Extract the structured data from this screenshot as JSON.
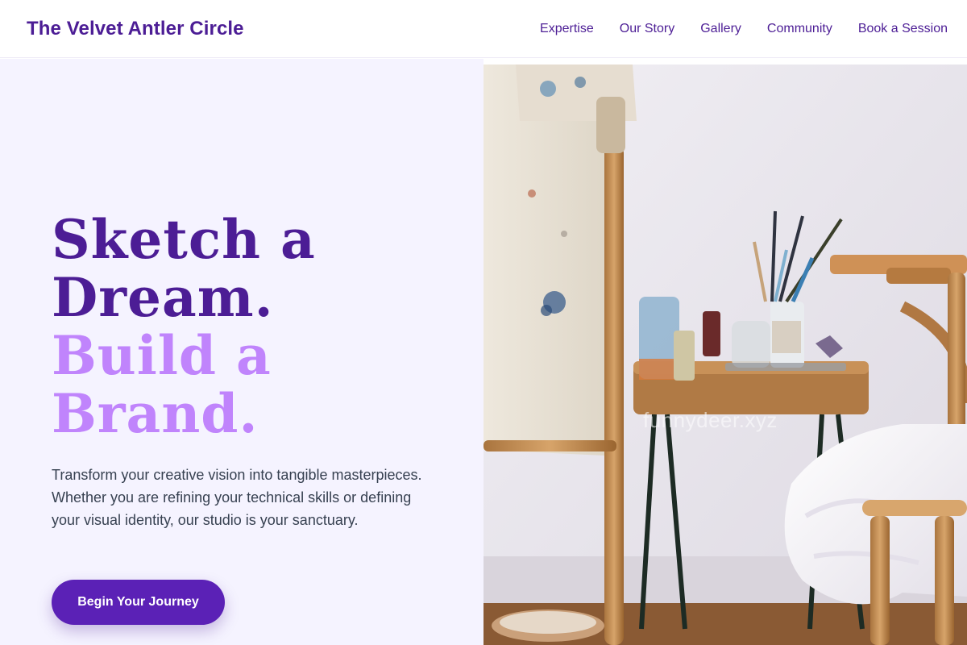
{
  "header": {
    "brand": "The Velvet Antler Circle",
    "nav": [
      {
        "label": "Expertise"
      },
      {
        "label": "Our Story"
      },
      {
        "label": "Gallery"
      },
      {
        "label": "Community"
      },
      {
        "label": "Book a Session"
      }
    ]
  },
  "hero": {
    "heading_lines": [
      "Sketch a",
      "Dream.",
      "Build a",
      "Brand."
    ],
    "body": "Transform your creative vision into tangible masterpieces. Whether you are refining your technical skills or defining your visual identity, our studio is your sanctuary.",
    "cta_label": "Begin Your Journey"
  },
  "photo": {
    "watermark": "funnydeer.xyz"
  },
  "colors": {
    "brand_purple": "#4c1d95",
    "accent_lilac": "#c084fc",
    "hero_background": "#f5f3ff",
    "button": "#5b21b6"
  }
}
